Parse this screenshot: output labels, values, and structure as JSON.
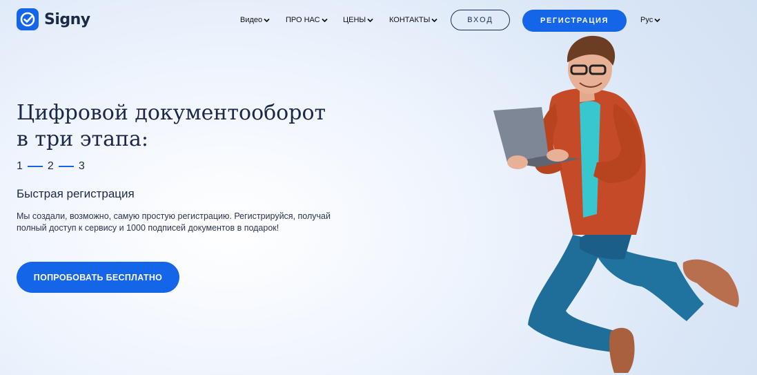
{
  "brand": {
    "name": "Signy",
    "accent": "#1565e8",
    "dark": "#1c2847"
  },
  "nav": {
    "items": [
      {
        "label": "Видео",
        "icon": "chevron-down-icon"
      },
      {
        "label": "ПРО НАС",
        "icon": "chevron-down-icon"
      },
      {
        "label": "ЦЕНЫ",
        "icon": "chevron-down-icon"
      },
      {
        "label": "КОНТАКТЫ",
        "icon": "chevron-down-icon"
      }
    ],
    "login_label": "ВХОД",
    "register_label": "РЕГИСТРАЦИЯ",
    "language": "Рус"
  },
  "hero": {
    "title_line1": "Цифровой документооборот",
    "title_line2": "в три этапа:",
    "steps": [
      "1",
      "2",
      "3"
    ],
    "subtitle": "Быстрая регистрация",
    "description": "Мы создали, возможно, самую простую регистрацию. Регистрируйся, получай полный доступ к сервису и 1000 подписей документов в подарок!",
    "cta_label": "ПОПРОБОВАТЬ БЕСПЛАТНО",
    "image": "man-jumping-with-laptop-photo"
  }
}
